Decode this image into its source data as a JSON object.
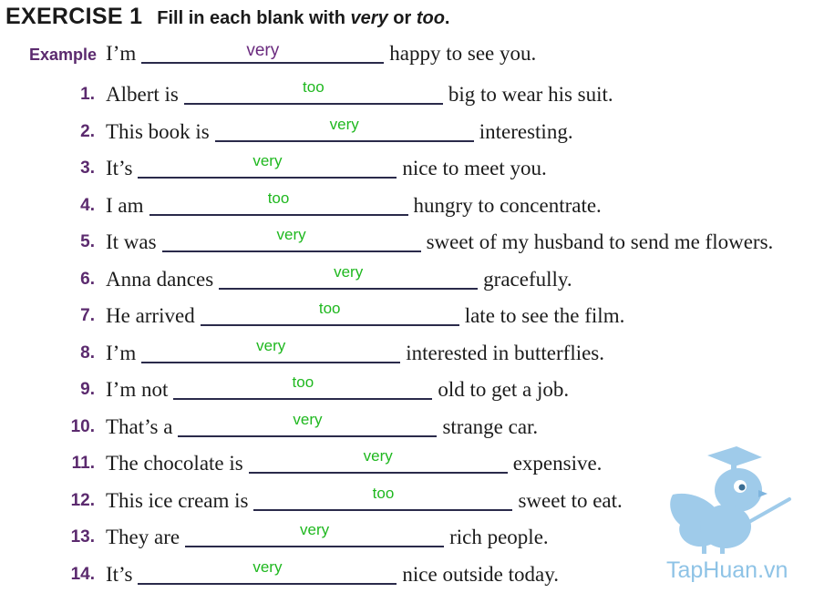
{
  "header": {
    "exercise_label": "EXERCISE 1",
    "instruction_prefix": "Fill in each blank with ",
    "option_a": "very",
    "instruction_or": " or ",
    "option_b": "too",
    "instruction_suffix": "."
  },
  "example": {
    "label": "Example",
    "before": "I’m",
    "answer": "very",
    "after": "happy to see you."
  },
  "items": [
    {
      "num": "1.",
      "before": "Albert is",
      "answer": "too",
      "after": "big to wear his suit."
    },
    {
      "num": "2.",
      "before": "This book is",
      "answer": "very",
      "after": "interesting."
    },
    {
      "num": "3.",
      "before": "It’s",
      "answer": "very",
      "after": "nice to meet you."
    },
    {
      "num": "4.",
      "before": "I am",
      "answer": "too",
      "after": "hungry to concentrate."
    },
    {
      "num": "5.",
      "before": "It was",
      "answer": "very",
      "after": "sweet of my husband to send me flowers."
    },
    {
      "num": "6.",
      "before": "Anna dances",
      "answer": "very",
      "after": "gracefully."
    },
    {
      "num": "7.",
      "before": "He arrived",
      "answer": "too",
      "after": "late to see the film."
    },
    {
      "num": "8.",
      "before": "I’m",
      "answer": "very",
      "after": "interested in butterflies."
    },
    {
      "num": "9.",
      "before": "I’m not",
      "answer": "too",
      "after": "old to get a job."
    },
    {
      "num": "10.",
      "before": "That’s a",
      "answer": "very",
      "after": "strange car."
    },
    {
      "num": "11.",
      "before": "The chocolate is",
      "answer": "very",
      "after": "expensive."
    },
    {
      "num": "12.",
      "before": "This ice cream is",
      "answer": "too",
      "after": "sweet to eat."
    },
    {
      "num": "13.",
      "before": "They are",
      "answer": "very",
      "after": "rich people."
    },
    {
      "num": "14.",
      "before": "It’s",
      "answer": "very",
      "after": "nice outside today."
    }
  ],
  "watermark": {
    "brand_text": "TapHuan.vn",
    "brand_color": "#8ec3e6",
    "mascot_icon": "bird-graduate-icon"
  },
  "colors": {
    "number": "#5b2a6e",
    "answer": "#1fb81f",
    "example_answer": "#6a2a7e"
  }
}
